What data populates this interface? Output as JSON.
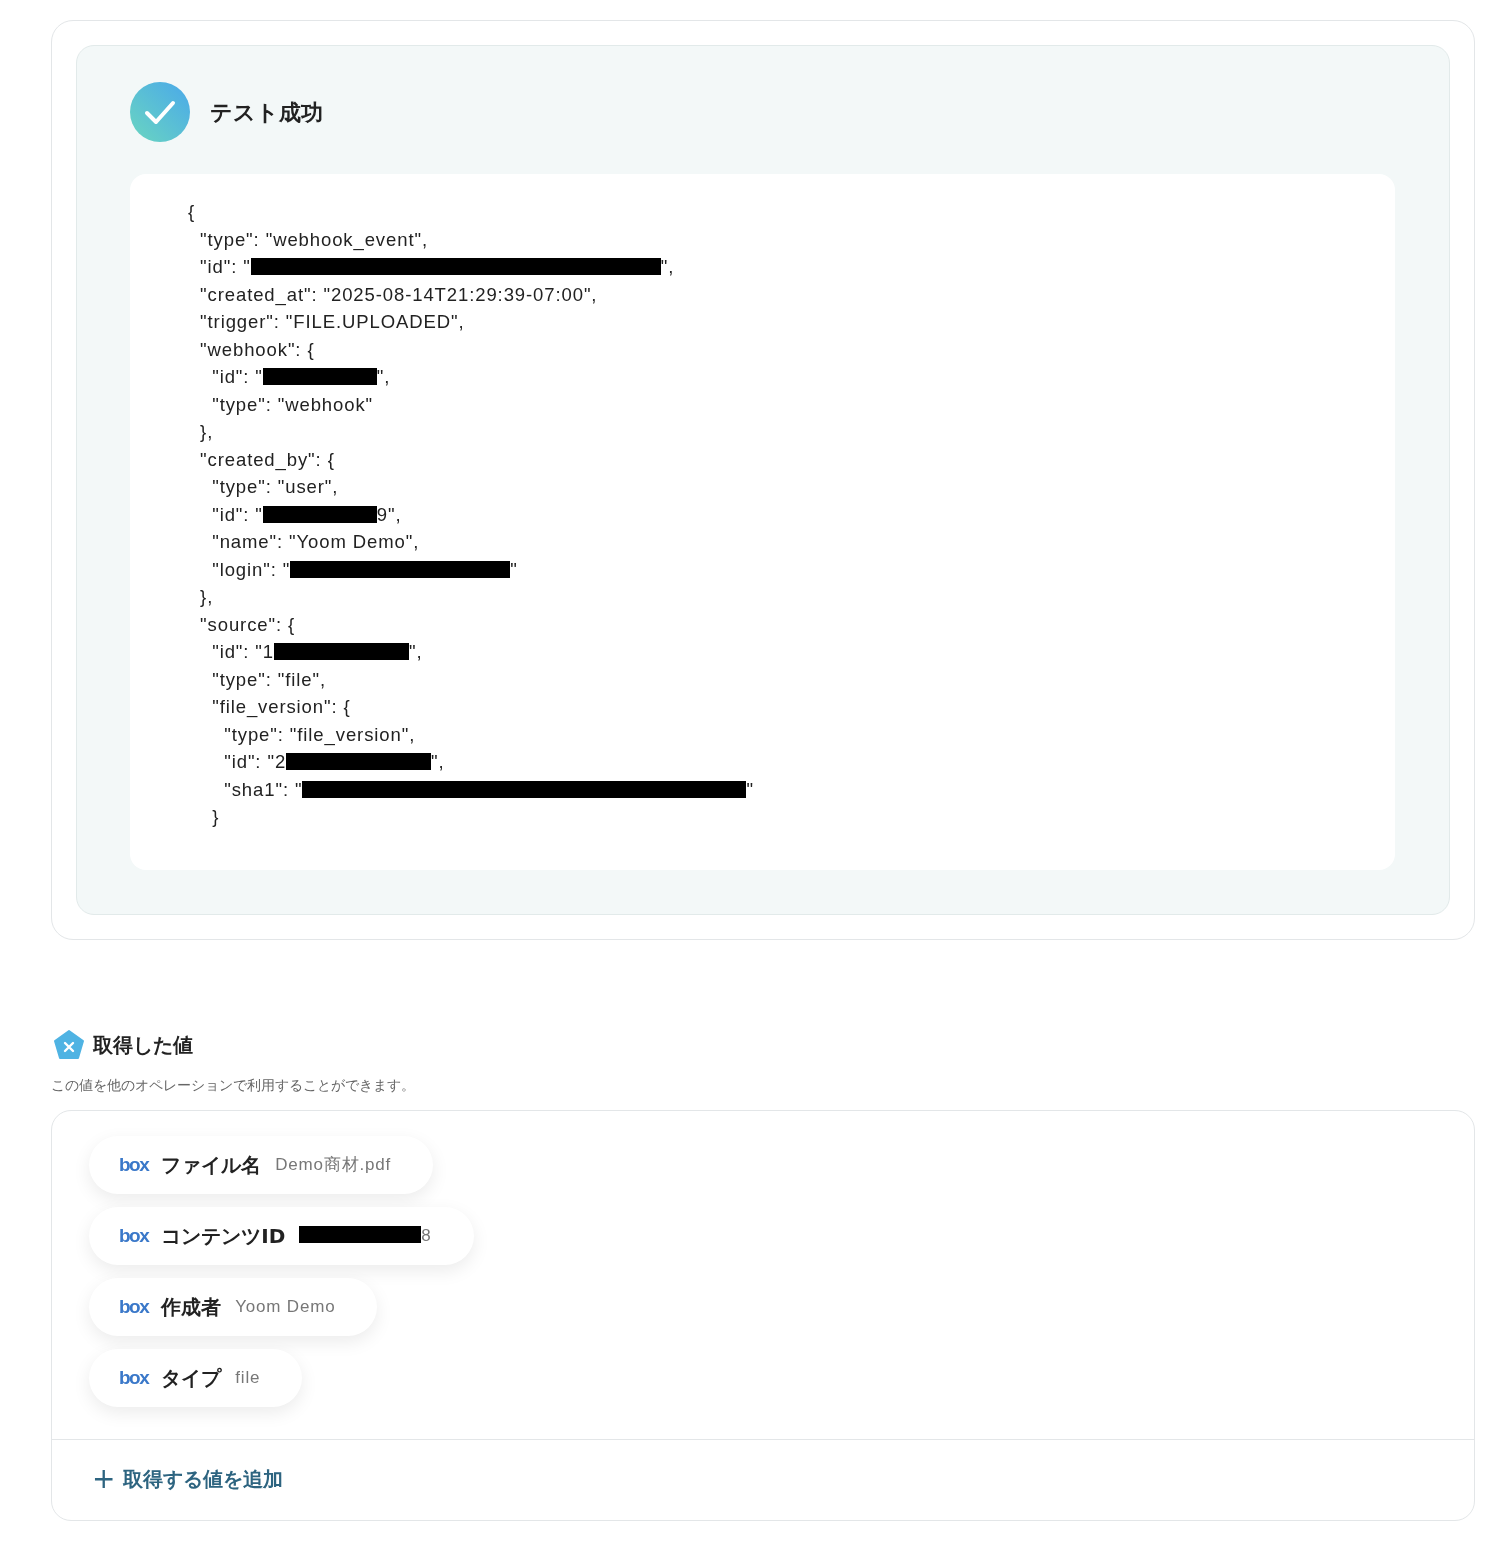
{
  "test_result": {
    "title": "テスト成功",
    "success": true,
    "code_lines": [
      [
        {
          "kind": "text",
          "text": "{"
        }
      ],
      [
        {
          "kind": "text",
          "text": "  \"type\": \"webhook_event\","
        }
      ],
      [
        {
          "kind": "text",
          "text": "  \"id\": \""
        },
        {
          "kind": "redacted"
        },
        {
          "kind": "text",
          "text": "\","
        }
      ],
      [
        {
          "kind": "text",
          "text": "  \"created_at\": \"2025-08-14T21:29:39-07:00\","
        }
      ],
      [
        {
          "kind": "text",
          "text": "  \"trigger\": \"FILE.UPLOADED\","
        }
      ],
      [
        {
          "kind": "text",
          "text": "  \"webhook\": {"
        }
      ],
      [
        {
          "kind": "text",
          "text": "    \"id\": \""
        },
        {
          "kind": "redacted"
        },
        {
          "kind": "text",
          "text": "\","
        }
      ],
      [
        {
          "kind": "text",
          "text": "    \"type\": \"webhook\""
        }
      ],
      [
        {
          "kind": "text",
          "text": "  },"
        }
      ],
      [
        {
          "kind": "text",
          "text": "  \"created_by\": {"
        }
      ],
      [
        {
          "kind": "text",
          "text": "    \"type\": \"user\","
        }
      ],
      [
        {
          "kind": "text",
          "text": "    \"id\": \""
        },
        {
          "kind": "redacted"
        },
        {
          "kind": "text",
          "text": "9\","
        }
      ],
      [
        {
          "kind": "text",
          "text": "    \"name\": \"Yoom Demo\","
        }
      ],
      [
        {
          "kind": "text",
          "text": "    \"login\": \""
        },
        {
          "kind": "redacted"
        },
        {
          "kind": "text",
          "text": "\""
        }
      ],
      [
        {
          "kind": "text",
          "text": "  },"
        }
      ],
      [
        {
          "kind": "text",
          "text": "  \"source\": {"
        }
      ],
      [
        {
          "kind": "text",
          "text": "    \"id\": \"1"
        },
        {
          "kind": "redacted"
        },
        {
          "kind": "text",
          "text": "\","
        }
      ],
      [
        {
          "kind": "text",
          "text": "    \"type\": \"file\","
        }
      ],
      [
        {
          "kind": "text",
          "text": "    \"file_version\": {"
        }
      ],
      [
        {
          "kind": "text",
          "text": "      \"type\": \"file_version\","
        }
      ],
      [
        {
          "kind": "text",
          "text": "      \"id\": \"2"
        },
        {
          "kind": "redacted"
        },
        {
          "kind": "text",
          "text": "\","
        }
      ],
      [
        {
          "kind": "text",
          "text": "      \"sha1\": \""
        },
        {
          "kind": "redacted"
        },
        {
          "kind": "text",
          "text": "\""
        }
      ],
      [
        {
          "kind": "text",
          "text": "    }"
        }
      ]
    ]
  },
  "retrieved_values": {
    "title": "取得した値",
    "description": "この値を他のオペレーションで利用することができます。",
    "items": [
      {
        "app": "box",
        "label": "ファイル名",
        "value": [
          {
            "kind": "text",
            "text": "Demo商材.pdf"
          }
        ]
      },
      {
        "app": "box",
        "label": "コンテンツID",
        "value": [
          {
            "kind": "redacted"
          },
          {
            "kind": "text",
            "text": "8"
          }
        ]
      },
      {
        "app": "box",
        "label": "作成者",
        "value": [
          {
            "kind": "text",
            "text": "Yoom Demo"
          }
        ]
      },
      {
        "app": "box",
        "label": "タイプ",
        "value": [
          {
            "kind": "text",
            "text": "file"
          }
        ]
      }
    ],
    "add_button": {
      "icon": "+",
      "label": "取得する値を追加"
    }
  }
}
